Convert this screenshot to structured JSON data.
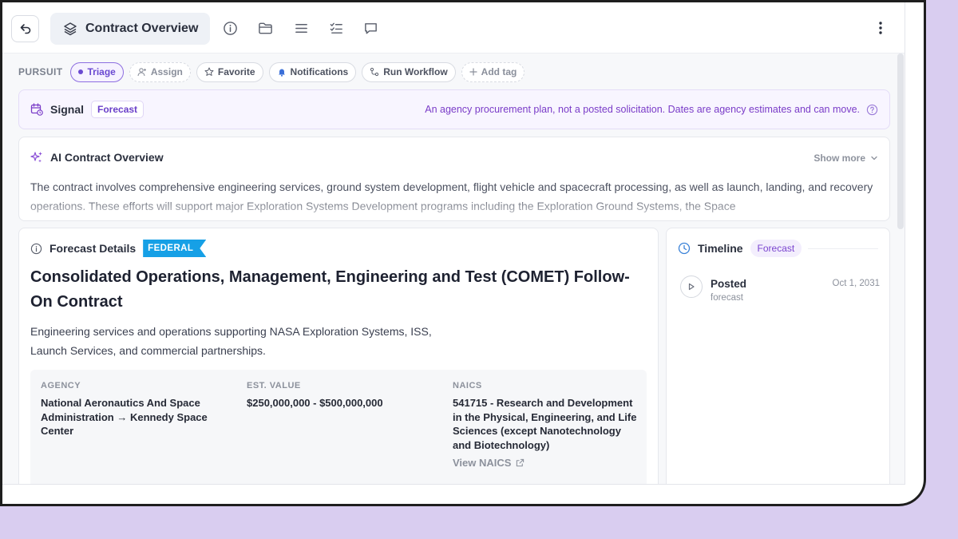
{
  "header": {
    "title": "Contract Overview",
    "icons": [
      "back-arrow-icon",
      "layers-icon",
      "info-icon",
      "folder-icon",
      "list-icon",
      "checklist-icon",
      "comment-icon",
      "more-vertical-icon"
    ]
  },
  "tags": {
    "label": "PURSUIT",
    "chips": [
      {
        "label": "Triage",
        "icon": "dot"
      },
      {
        "label": "Assign",
        "icon": "user-plus-icon"
      },
      {
        "label": "Favorite",
        "icon": "star-icon"
      },
      {
        "label": "Notifications",
        "icon": "bell-icon"
      },
      {
        "label": "Run Workflow",
        "icon": "workflow-icon"
      },
      {
        "label": "Add tag",
        "icon": "plus-icon"
      }
    ]
  },
  "signal": {
    "title": "Signal",
    "badge": "Forecast",
    "note": "An agency procurement plan, not a posted solicitation. Dates are agency estimates and can move."
  },
  "overview": {
    "title": "AI Contract Overview",
    "show_more": "Show more",
    "text": "The contract involves comprehensive engineering services, ground system development, flight vehicle and spacecraft processing, as well as launch, landing, and recovery operations. These efforts will support major Exploration Systems Development programs including the Exploration Ground Systems, the Space"
  },
  "details": {
    "section_title": "Forecast Details",
    "badge": "FEDERAL",
    "contract_title": "Consolidated Operations, Management, Engineering and Test (COMET) Follow-On Contract",
    "description_line1": "Engineering services and operations supporting NASA Exploration Systems, ISS,",
    "description_line2": "Launch Services, and commercial partnerships.",
    "agency_label": "AGENCY",
    "agency_value": "National Aeronautics And Space Administration → Kennedy Space Center",
    "value_label": "EST. VALUE",
    "value_value": "$250,000,000 - $500,000,000",
    "naics_label": "NAICS",
    "naics_value": "541715 - Research and Development in the Physical, Engineering, and Life Sciences (except Nanotechnology and Biotechnology)",
    "view_naics": "View NAICS"
  },
  "timeline": {
    "title": "Timeline",
    "badge": "Forecast",
    "events": [
      {
        "name": "Posted",
        "sub": "forecast",
        "date": "Oct 1, 2031"
      }
    ]
  },
  "colors": {
    "accent": "#6a49d1",
    "federal": "#16a0e6",
    "signal_text": "#7a3cc8",
    "backdrop": "#d9cdf0"
  }
}
